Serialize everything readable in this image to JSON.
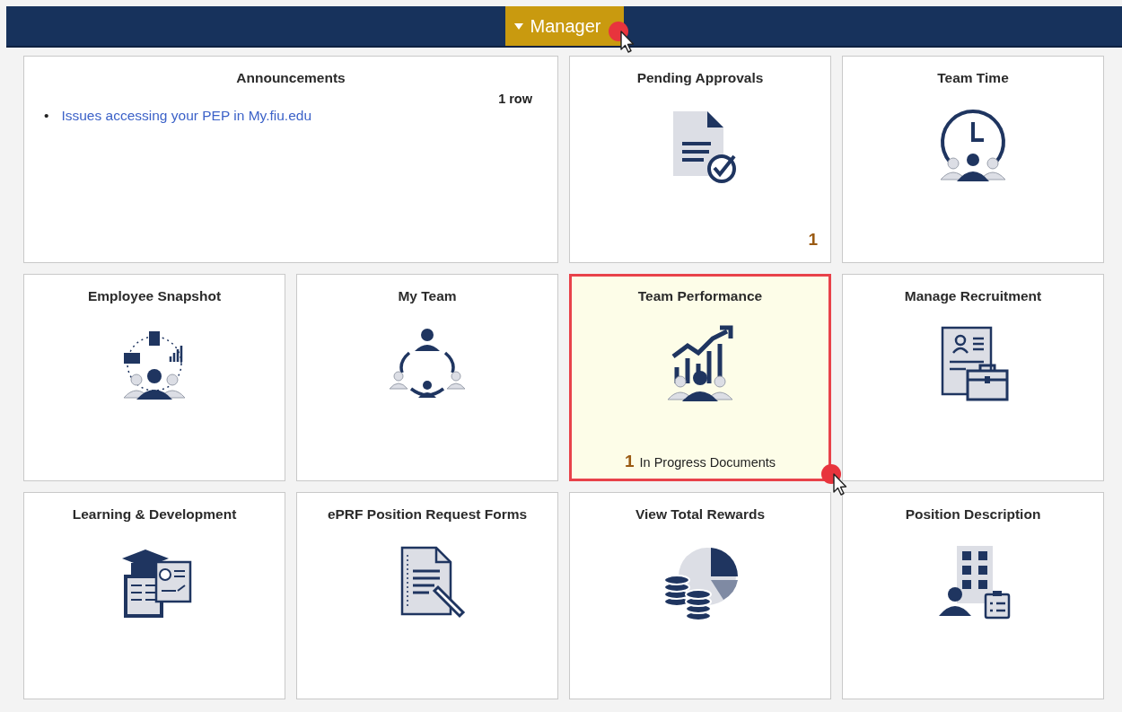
{
  "header": {
    "menu": {
      "label": "Manager",
      "expanded": true,
      "click_marker": true
    }
  },
  "tiles": [
    {
      "kind": "list",
      "title": "Announcements",
      "row_count": "1 row",
      "bullet": "•",
      "items": [
        "Issues accessing your PEP in My.fiu.edu"
      ],
      "selected": false,
      "click_marker": false
    },
    {
      "kind": "tile",
      "title": "Pending Approvals",
      "count": "1",
      "selected": false,
      "click_marker": false
    },
    {
      "kind": "tile",
      "title": "Team Time",
      "selected": false,
      "click_marker": false
    },
    {
      "kind": "tile",
      "title": "Employee Snapshot",
      "selected": false,
      "click_marker": false
    },
    {
      "kind": "tile",
      "title": "My Team",
      "selected": false,
      "click_marker": false
    },
    {
      "kind": "tile",
      "title": "Team Performance",
      "count": "1",
      "count_label": "In Progress Documents",
      "selected": true,
      "click_marker": true
    },
    {
      "kind": "tile",
      "title": "Manage Recruitment",
      "selected": false,
      "click_marker": false
    },
    {
      "kind": "tile",
      "title": "Learning & Development",
      "selected": false,
      "click_marker": false
    },
    {
      "kind": "tile",
      "title": "ePRF Position Request Forms",
      "selected": false,
      "click_marker": false
    },
    {
      "kind": "tile",
      "title": "View Total Rewards",
      "selected": false,
      "click_marker": false
    },
    {
      "kind": "tile",
      "title": "Position Description",
      "selected": false,
      "click_marker": false
    }
  ]
}
